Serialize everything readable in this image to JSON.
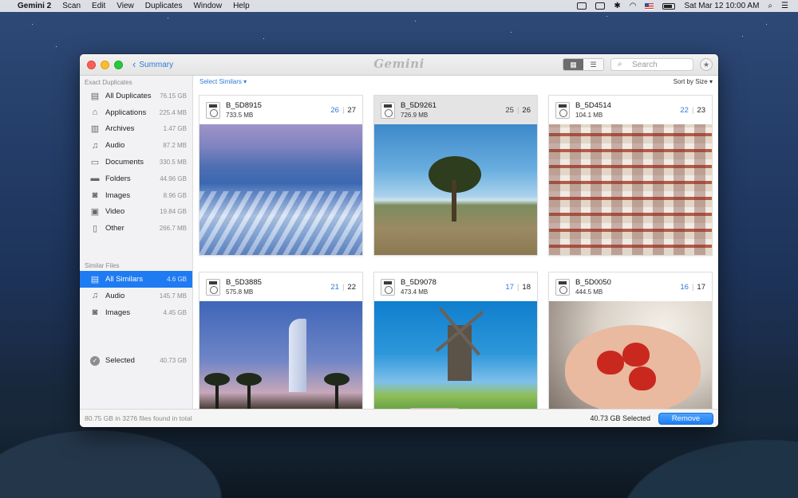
{
  "menubar": {
    "app_name": "Gemini 2",
    "menus": [
      "Scan",
      "Edit",
      "View",
      "Duplicates",
      "Window",
      "Help"
    ],
    "clock": "Sat Mar 12  10:00 AM"
  },
  "window": {
    "back_label": "Summary",
    "logo": "Gemini",
    "search_placeholder": "Search",
    "select_similars": "Select Similars ▾",
    "sort_label": "Sort by Size ▾"
  },
  "sidebar": {
    "exact_title": "Exact Duplicates",
    "exact_items": [
      {
        "label": "All Duplicates",
        "size": "76.15 GB",
        "icon": "disk-icon"
      },
      {
        "label": "Applications",
        "size": "225.4 MB",
        "icon": "apps-icon"
      },
      {
        "label": "Archives",
        "size": "1.47 GB",
        "icon": "archive-icon"
      },
      {
        "label": "Audio",
        "size": "87.2 MB",
        "icon": "music-icon"
      },
      {
        "label": "Documents",
        "size": "330.5 MB",
        "icon": "document-icon"
      },
      {
        "label": "Folders",
        "size": "44.96 GB",
        "icon": "folder-icon"
      },
      {
        "label": "Images",
        "size": "8.96 GB",
        "icon": "camera-icon"
      },
      {
        "label": "Video",
        "size": "19.84 GB",
        "icon": "film-icon"
      },
      {
        "label": "Other",
        "size": "266.7 MB",
        "icon": "file-icon"
      }
    ],
    "similar_title": "Similar Files",
    "similar_items": [
      {
        "label": "All Similars",
        "size": "4.6 GB",
        "icon": "disk-icon"
      },
      {
        "label": "Audio",
        "size": "145.7 MB",
        "icon": "music-icon"
      },
      {
        "label": "Images",
        "size": "4.45 GB",
        "icon": "camera-icon"
      }
    ],
    "selected_label": "Selected",
    "selected_size": "40.73 GB"
  },
  "cards": [
    {
      "name": "B_5D8915",
      "size": "733.5 MB",
      "a": "26",
      "b": "27"
    },
    {
      "name": "B_5D9261",
      "size": "726.9 MB",
      "a": "25",
      "b": "26"
    },
    {
      "name": "B_5D4514",
      "size": "104.1 MB",
      "a": "22",
      "b": "23"
    },
    {
      "name": "B_5D3885",
      "size": "575.8 MB",
      "a": "21",
      "b": "22"
    },
    {
      "name": "B_5D9078",
      "size": "473.4 MB",
      "a": "17",
      "b": "18"
    },
    {
      "name": "B_5D0050",
      "size": "444.5 MB",
      "a": "16",
      "b": "17"
    }
  ],
  "footer": {
    "summary": "80.75 GB in 3276 files found in total",
    "selected_total": "40.73 GB Selected",
    "remove_label": "Remove"
  },
  "colors": {
    "accent": "#1f7bf2",
    "link": "#2f7bd9"
  }
}
